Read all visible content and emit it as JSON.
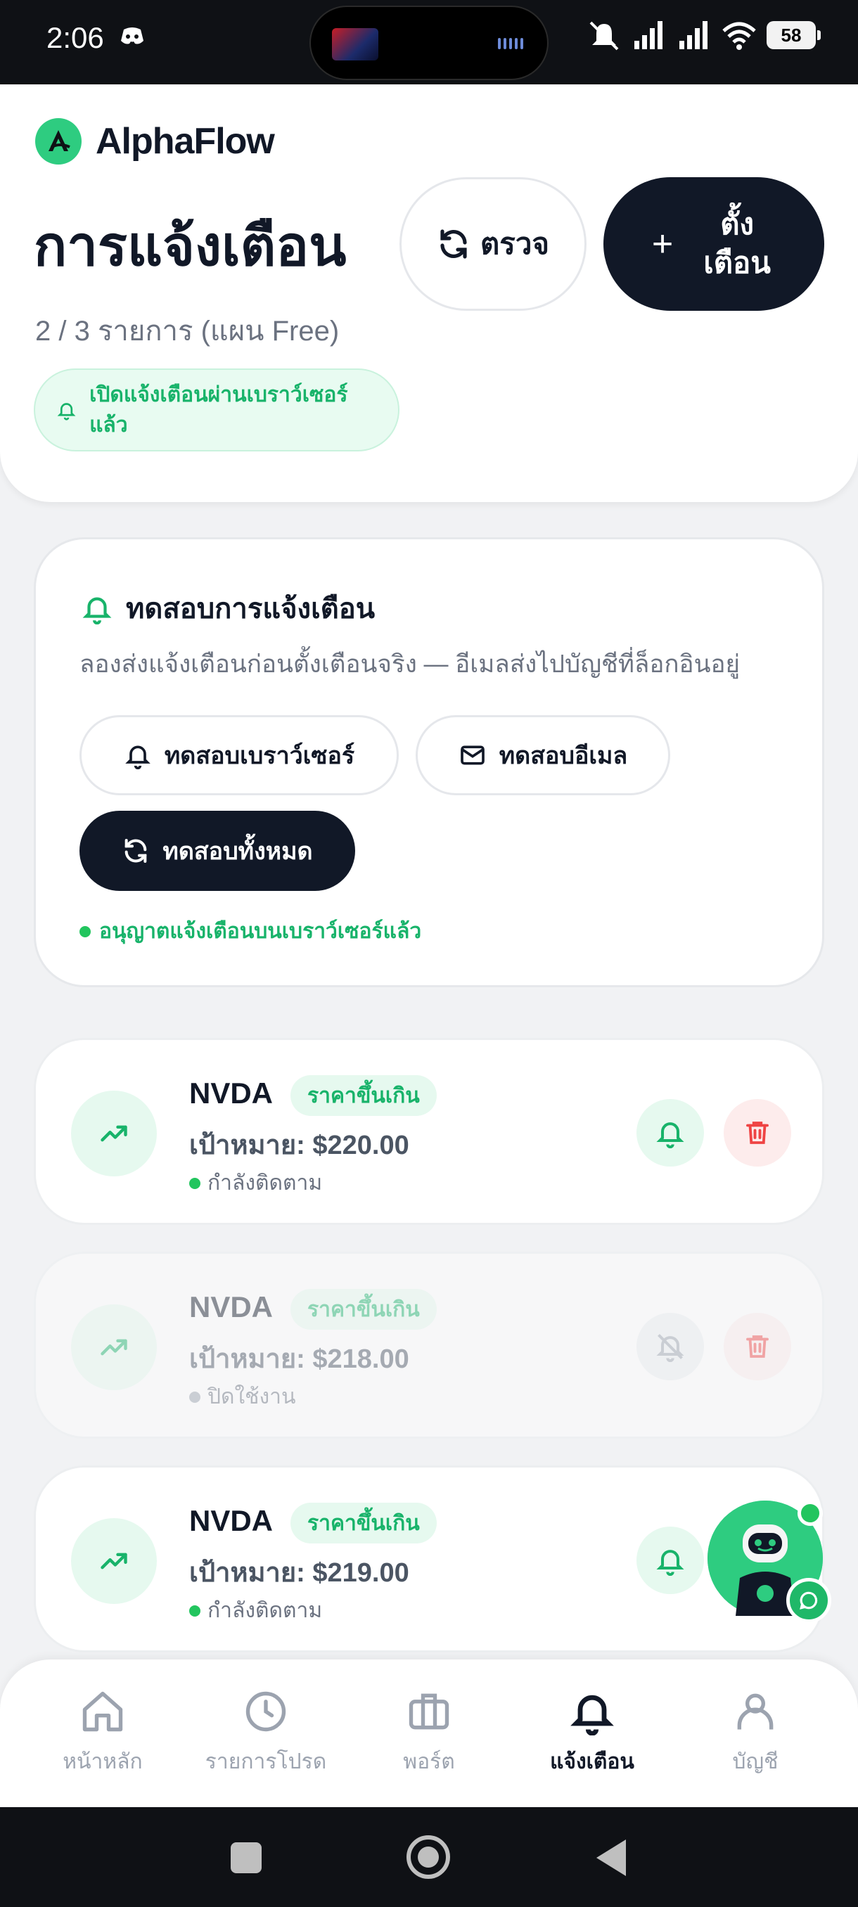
{
  "status_bar": {
    "time": "2:06",
    "battery": "58"
  },
  "app": {
    "name": "AlphaFlow"
  },
  "header": {
    "title": "การแจ้งเตือน",
    "subtitle": "2 / 3 รายการ (แผน Free)",
    "browser_enabled": "เปิดแจ้งเตือนผ่านเบราว์เซอร์แล้ว",
    "check_label": "ตรวจ",
    "set_alert_label": "ตั้งเตือน"
  },
  "test_panel": {
    "title": "ทดสอบการแจ้งเตือน",
    "description": "ลองส่งแจ้งเตือนก่อนตั้งเตือนจริง — อีเมลส่งไปบัญชีที่ล็อกอินอยู่",
    "browser_button": "ทดสอบเบราว์เซอร์",
    "email_button": "ทดสอบอีเมล",
    "all_button": "ทดสอบทั้งหมด",
    "permission_text": "อนุญาตแจ้งเตือนบนเบราว์เซอร์แล้ว"
  },
  "alerts": [
    {
      "symbol": "NVDA",
      "condition": "ราคาขึ้นเกิน",
      "target": "เป้าหมาย: $220.00",
      "status": "กำลังติดตาม",
      "enabled": true
    },
    {
      "symbol": "NVDA",
      "condition": "ราคาขึ้นเกิน",
      "target": "เป้าหมาย: $218.00",
      "status": "ปิดใช้งาน",
      "enabled": false
    },
    {
      "symbol": "NVDA",
      "condition": "ราคาขึ้นเกิน",
      "target": "เป้าหมาย: $219.00",
      "status": "กำลังติดตาม",
      "enabled": true
    }
  ],
  "nav": {
    "home": "หน้าหลัก",
    "watchlist": "รายการโปรด",
    "portfolio": "พอร์ต",
    "alerts": "แจ้งเตือน",
    "account": "บัญชี",
    "active": "alerts"
  },
  "colors": {
    "accent": "#2ecc80",
    "dark": "#111827",
    "danger": "#ef4444"
  }
}
